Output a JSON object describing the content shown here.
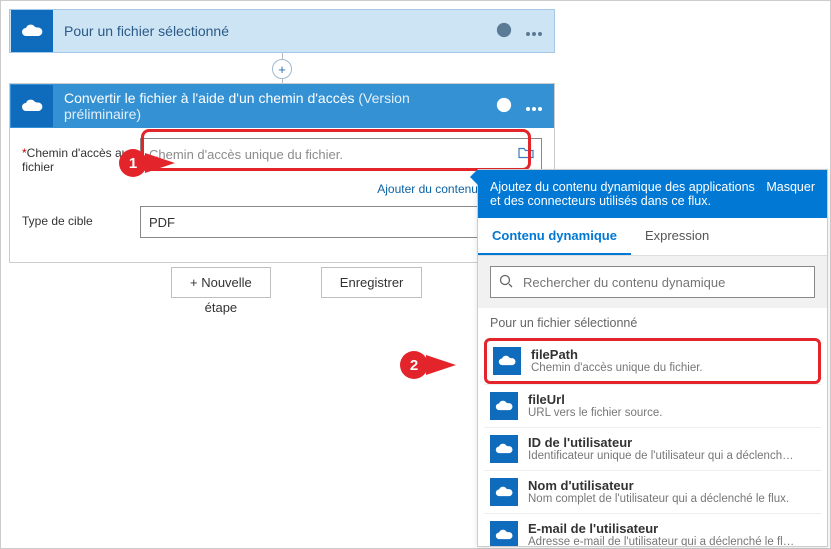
{
  "trigger": {
    "title": "Pour un fichier sélectionné"
  },
  "step": {
    "title": "Convertir le fichier à l'aide d'un chemin d'accès",
    "preview": "(Version préliminaire)",
    "fields": {
      "path_label": "Chemin d'accès au fichier",
      "path_placeholder": "Chemin d'accès unique du fichier.",
      "add_dynamic_link": "Ajouter du contenu dynamique",
      "target_label": "Type de cible",
      "target_value": "PDF"
    }
  },
  "buttons": {
    "new_step_top": "+ Nouvelle",
    "new_step_bottom": "étape",
    "save": "Enregistrer"
  },
  "dc": {
    "banner_text": "Ajoutez du contenu dynamique des applications et des connecteurs utilisés dans ce flux.",
    "hide_label": "Masquer",
    "tab_dynamic": "Contenu dynamique",
    "tab_expression": "Expression",
    "search_placeholder": "Rechercher du contenu dynamique",
    "section_title": "Pour un fichier sélectionné",
    "items": [
      {
        "name": "filePath",
        "desc": "Chemin d'accès unique du fichier."
      },
      {
        "name": "fileUrl",
        "desc": "URL vers le fichier source."
      },
      {
        "name": "ID de l'utilisateur",
        "desc": "Identificateur unique de l'utilisateur qui a déclenché le flux d..."
      },
      {
        "name": "Nom d'utilisateur",
        "desc": "Nom complet de l'utilisateur qui a déclenché le flux."
      },
      {
        "name": "E-mail de l'utilisateur",
        "desc": "Adresse e-mail de l'utilisateur qui a déclenché le flux."
      }
    ]
  },
  "callouts": {
    "one": "1",
    "two": "2"
  }
}
